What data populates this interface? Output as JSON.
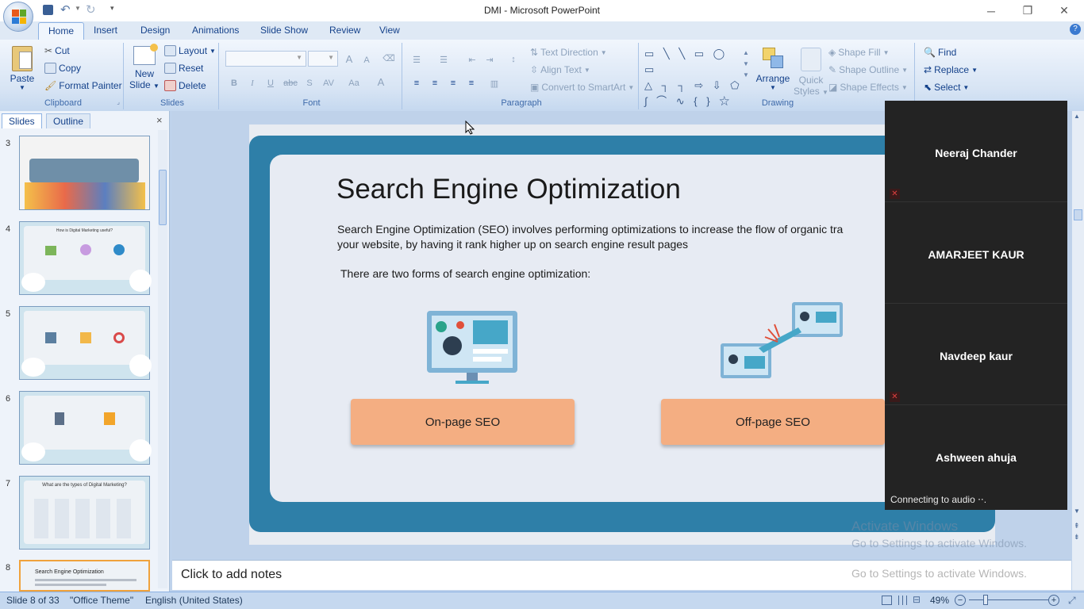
{
  "window": {
    "title": "DMI - Microsoft PowerPoint"
  },
  "tabs": [
    "Home",
    "Insert",
    "Design",
    "Animations",
    "Slide Show",
    "Review",
    "View"
  ],
  "clipboard": {
    "paste": "Paste",
    "cut": "Cut",
    "copy": "Copy",
    "format_painter": "Format Painter",
    "label": "Clipboard"
  },
  "slides_group": {
    "new_slide_1": "New",
    "new_slide_2": "Slide",
    "layout": "Layout",
    "reset": "Reset",
    "delete": "Delete",
    "label": "Slides"
  },
  "font_group": {
    "label": "Font",
    "bold": "B",
    "italic": "I",
    "underline": "U",
    "strike": "abc",
    "shadow": "S",
    "spacing": "AV",
    "case": "Aa",
    "color": "A",
    "grow": "A",
    "shrink": "A"
  },
  "paragraph_group": {
    "text_direction": "Text Direction",
    "align_text": "Align Text",
    "convert": "Convert to SmartArt",
    "label": "Paragraph"
  },
  "drawing_group": {
    "arrange": "Arrange",
    "quick_styles_1": "Quick",
    "quick_styles_2": "Styles",
    "shape_fill": "Shape Fill",
    "shape_outline": "Shape Outline",
    "shape_effects": "Shape Effects",
    "label": "Drawing"
  },
  "editing_group": {
    "find": "Find",
    "replace": "Replace",
    "select": "Select"
  },
  "left_panel": {
    "tab_slides": "Slides",
    "tab_outline": "Outline",
    "close": "×"
  },
  "thumbnails": [
    {
      "num": "3",
      "title": ""
    },
    {
      "num": "4",
      "title": "How is Digital Marketing useful?"
    },
    {
      "num": "5",
      "title": ""
    },
    {
      "num": "6",
      "title": ""
    },
    {
      "num": "7",
      "title": "What are the types of Digital Marketing?"
    },
    {
      "num": "8",
      "title": "Search Engine Optimization"
    }
  ],
  "slide": {
    "title": "Search Engine Optimization",
    "body_line1": "Search Engine Optimization (SEO) involves performing optimizations to increase the flow of organic tra",
    "body_line2": "your website, by having it rank higher up on search engine result pages",
    "forms": "There are two forms of search engine optimization:",
    "onpage": "On-page SEO",
    "offpage": "Off-page SEO"
  },
  "notes": {
    "placeholder": "Click to add notes"
  },
  "video": {
    "participants": [
      "Neeraj Chander",
      "AMARJEET KAUR",
      "Navdeep kaur",
      "Ashween ahuja"
    ],
    "status": "Connecting to audio ⋅⋅."
  },
  "watermark": {
    "line1": "Activate Windows",
    "line2": "Go to Settings to activate Windows.",
    "line3": "Go to Settings to activate Windows."
  },
  "statusbar": {
    "slide_info": "Slide 8 of 33",
    "theme": "\"Office Theme\"",
    "language": "English (United States)",
    "zoom": "49%"
  },
  "colors": {
    "ribbon": "#dfe9f5",
    "slide_frame": "#2e7fa8",
    "button_orange": "#f4ae82",
    "video_bg": "#232323"
  }
}
